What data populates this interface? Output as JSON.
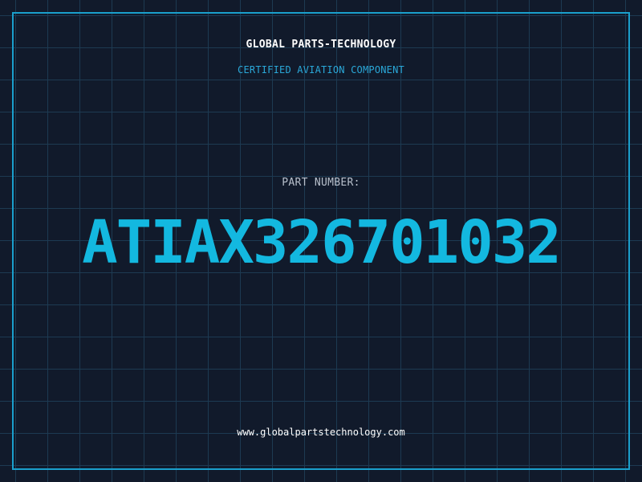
{
  "header": {
    "company_name": "GLOBAL PARTS-TECHNOLOGY",
    "tagline": "CERTIFIED AVIATION COMPONENT"
  },
  "part": {
    "label": "PART NUMBER:",
    "number": "ATIAX326701032"
  },
  "footer": {
    "website": "www.globalpartstechnology.com"
  },
  "colors": {
    "background": "#111a2b",
    "grid": "#1d3a52",
    "frame": "#1a9fcc",
    "accent": "#13b8e0",
    "tagline": "#2aa8d8",
    "label": "#b8c0cc",
    "text": "#ffffff"
  }
}
